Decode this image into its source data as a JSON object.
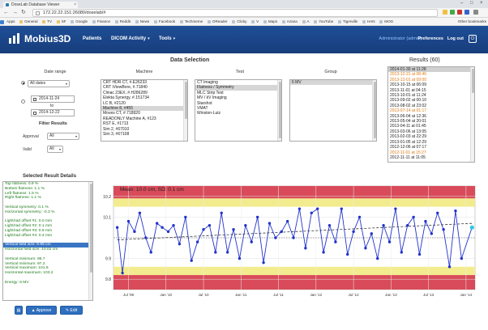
{
  "browser": {
    "tab_title": "DoseLab Database Viewer",
    "url": "172.22.22.151:26080/doselab/#",
    "bookmarks": [
      "Apps",
      "General",
      "TV",
      "SF",
      "Google",
      "Finance",
      "Reddit",
      "News",
      "Facebook",
      "Techmeme",
      "OReader",
      "Clicky",
      "V",
      "Maps",
      "Azana",
      "A",
      "YouTube",
      "Tigerville",
      "HAN",
      "MOG"
    ],
    "other_bookmarks": "Other bookmarks"
  },
  "nav": {
    "logo": "Mobius3D",
    "items": [
      "Patients",
      "DICOM Activity",
      "Tools"
    ],
    "admin": "Administrator (admin)",
    "preferences": "Preferences",
    "logout": "Log out"
  },
  "data_selection": {
    "title": "Data Selection",
    "date_range": {
      "heading": "Date range",
      "all_dates": "All dates",
      "start": "2014-11-24",
      "to": "to",
      "end": "2014-12-22"
    },
    "filter_results": {
      "heading": "Filter Results",
      "approval_label": "Approval",
      "approval_value": "All",
      "valid_label": "Valid",
      "valid_value": "All"
    },
    "machine": {
      "heading": "Machine",
      "items": [
        "CRT HDR CT, #.E26233",
        "CRT iViewBore, #.71840",
        "Clinac 23EX, #.H286289",
        "Elekta Synergy, #.151734",
        "LC B, #2120",
        "Machine 8, #455",
        "Moves CT, #.718920",
        "READONLY Machine A, #123",
        "RST E, #1713",
        "Sim 2, #67010",
        "Sim 3, #67108"
      ],
      "selected": 5
    },
    "test": {
      "heading": "Test",
      "items": [
        "CT Imaging",
        "Flatness / Symmetry",
        "MLC Strip Test",
        "MV / kV Imaging",
        "Starshot",
        "VMAT",
        "Winston-Lutz"
      ],
      "selected": 1
    },
    "group": {
      "heading": "Group",
      "items": [
        "6 MV"
      ],
      "selected": 0
    }
  },
  "results": {
    "title": "Results (60)",
    "items": [
      {
        "t": "2014-01-30 at 11:28",
        "c": "black"
      },
      {
        "t": "2013-12-21 at 08:46",
        "c": "orange"
      },
      {
        "t": "2013-12-01 at 09:00",
        "c": "orange"
      },
      {
        "t": "2013-10-15 at 06:09",
        "c": "black"
      },
      {
        "t": "2013-11-01 at 04:15",
        "c": "black"
      },
      {
        "t": "2013-10-01 at 11:24",
        "c": "black"
      },
      {
        "t": "2013-09-02 at 00:10",
        "c": "black"
      },
      {
        "t": "2013-08-02 at 23:02",
        "c": "black"
      },
      {
        "t": "2013-07-14 at 01:17",
        "c": "orange"
      },
      {
        "t": "2013-06-04 at 12:36",
        "c": "black"
      },
      {
        "t": "2013-05-04 at 20:01",
        "c": "black"
      },
      {
        "t": "2013-04-11 at 01:45",
        "c": "black"
      },
      {
        "t": "2013-03-06 at 13:05",
        "c": "black"
      },
      {
        "t": "2013-02-03 at 22:29",
        "c": "black"
      },
      {
        "t": "2013-01-05 at 12:29",
        "c": "black"
      },
      {
        "t": "2012-12-06 at 07:17",
        "c": "black"
      },
      {
        "t": "2012-11-01 at 15:27",
        "c": "orange"
      },
      {
        "t": "2012-11-11 at 11:05",
        "c": "black"
      }
    ],
    "selected": 0
  },
  "details": {
    "title": "Selected Result Details",
    "lines": [
      "Top flatness: 0.9 %",
      "Bottom flatness: 1.1 %",
      "Left flatness: 1.5 %",
      "Right flatness: 1.1 %",
      "",
      "Vertical symmetry: 0.1 %",
      "Horizontal symmetry: -0.3 %",
      "",
      "Light/rad offset #1: 0.0 mm",
      "Light/rad offset #2: 0.1 mm",
      "Light/rad offset #3: 0.9 mm",
      "Light/rad offset #4: 0.4 mm",
      "",
      "Vertical field size: 9.99 cm",
      "Horizontal field size: 10.02 cm",
      "",
      "Vertical minimum: 96.7",
      "Vertical minimum: 97.2",
      "Vertical maximum: 101.6",
      "Horizontal maximum: 103.2",
      "",
      "Energy: 6 MV"
    ],
    "highlight": 13,
    "approve": "Approve",
    "edit": "Edit"
  },
  "chart_data": {
    "type": "line",
    "title": "Mean: 10.0 cm, SD: 0.1 cm",
    "ylim": [
      9.75,
      10.25
    ],
    "yticks": [
      9.8,
      9.9,
      10.0,
      10.1,
      10.2
    ],
    "ytick_labels": [
      "9.8",
      "9.9",
      "",
      "10.1",
      "10.2"
    ],
    "xlim": [
      2009.3,
      2014.12
    ],
    "xticks": [
      {
        "x": 2009.5,
        "label": "Jul '09"
      },
      {
        "x": 2010.0,
        "label": "Jan '10"
      },
      {
        "x": 2010.5,
        "label": "Jul '10"
      },
      {
        "x": 2011.0,
        "label": "Jan '11"
      },
      {
        "x": 2011.5,
        "label": "Jul '11"
      },
      {
        "x": 2012.0,
        "label": "Jan '12"
      },
      {
        "x": 2012.5,
        "label": "Jul '12"
      },
      {
        "x": 2013.0,
        "label": "Jan '13"
      },
      {
        "x": 2013.5,
        "label": "Jul '13"
      },
      {
        "x": 2014.0,
        "label": "Jan '14"
      }
    ],
    "bands": {
      "upper": [
        10.19,
        10.25
      ],
      "lower": [
        9.75,
        9.82
      ],
      "warn_upper": [
        10.15,
        10.19
      ],
      "warn_lower": [
        9.82,
        9.86
      ]
    },
    "mean": 10.0,
    "trend": [
      [
        2009.35,
        9.99
      ],
      [
        2014.1,
        10.07
      ]
    ],
    "x": [
      2009.35,
      2009.42,
      2009.5,
      2009.58,
      2009.65,
      2009.73,
      2009.8,
      2009.88,
      2009.95,
      2010.03,
      2010.1,
      2010.18,
      2010.26,
      2010.34,
      2010.42,
      2010.5,
      2010.58,
      2010.66,
      2010.74,
      2010.82,
      2010.9,
      2010.98,
      2011.06,
      2011.14,
      2011.22,
      2011.3,
      2011.38,
      2011.46,
      2011.54,
      2011.62,
      2011.7,
      2011.78,
      2011.86,
      2011.94,
      2012.02,
      2012.1,
      2012.18,
      2012.26,
      2012.34,
      2012.42,
      2012.5,
      2012.58,
      2012.66,
      2012.74,
      2012.82,
      2012.9,
      2012.98,
      2013.06,
      2013.14,
      2013.22,
      2013.3,
      2013.38,
      2013.46,
      2013.54,
      2013.62,
      2013.7,
      2013.78,
      2013.86,
      2013.94,
      2014.08
    ],
    "values": [
      10.05,
      9.83,
      10.08,
      10.03,
      10.12,
      10.0,
      9.93,
      10.07,
      10.05,
      10.03,
      10.06,
      9.97,
      10.1,
      9.89,
      9.98,
      10.04,
      10.06,
      9.93,
      10.12,
      9.93,
      10.04,
      9.9,
      10.06,
      9.98,
      10.1,
      9.88,
      10.07,
      10.0,
      10.03,
      10.08,
      10.0,
      10.14,
      9.95,
      10.12,
      10.14,
      9.93,
      10.06,
      9.98,
      10.14,
      9.92,
      10.03,
      10.1,
      9.95,
      10.02,
      9.9,
      10.06,
      9.98,
      10.14,
      9.93,
      10.06,
      10.1,
      9.92,
      10.08,
      10.02,
      10.12,
      10.04,
      9.86,
      10.13,
      9.9,
      10.05
    ],
    "line_color": "#2233cc",
    "band_red": "#d94b5a",
    "band_yellow": "#f3ec8f",
    "last_point_color": "#2fc8e8"
  }
}
